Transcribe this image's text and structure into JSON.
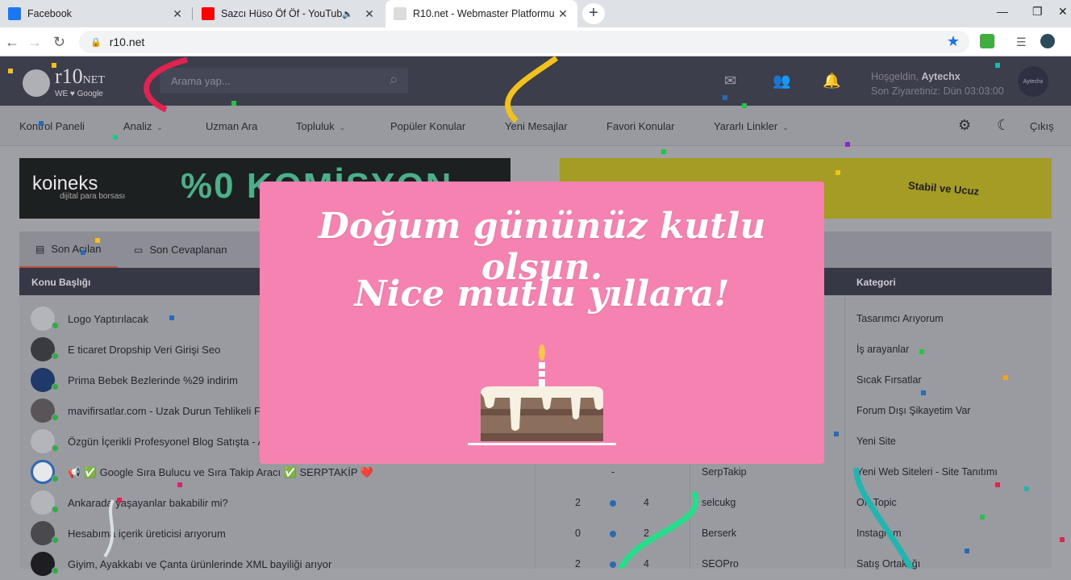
{
  "browser": {
    "tabs": [
      {
        "title": "Facebook",
        "favicon_color": "#1877f2"
      },
      {
        "title": "Sazcı Hüso Öf Öf - YouTube",
        "favicon_color": "#ff0000"
      },
      {
        "title": "R10.net - Webmaster Platformu",
        "favicon_color": "#333333"
      }
    ],
    "new_tab": "+",
    "url": "r10.net"
  },
  "site": {
    "logo_main": "r10",
    "logo_net": "NET",
    "logo_sub": "WE ♥ Google",
    "search_placeholder": "Arama yap...",
    "welcome_prefix": "Hoşgeldin, ",
    "username": "Aytechx",
    "last_visit": "Son Ziyaretiniz: Dün 03:03:00",
    "avatar_label": "Aytechx"
  },
  "menu": {
    "items": [
      {
        "label": "Kontrol Paneli",
        "caret": false
      },
      {
        "label": "Analiz",
        "caret": true
      },
      {
        "label": "Uzman Ara",
        "caret": false
      },
      {
        "label": "Topluluk",
        "caret": true
      },
      {
        "label": "Popüler Konular",
        "caret": false
      },
      {
        "label": "Yeni Mesajlar",
        "caret": false
      },
      {
        "label": "Favori Konular",
        "caret": false
      },
      {
        "label": "Yararlı Linkler",
        "caret": true
      }
    ],
    "logout": "Çıkış"
  },
  "banners": {
    "left_brand": "koineks",
    "left_tagline": "dijital para borsası",
    "left_headline": "%0 KOMİSYON",
    "right_text": "Stabil ve Ucuz"
  },
  "panel": {
    "tabs": [
      "Son Açılan",
      "Son Cevaplanan"
    ],
    "headers": {
      "topic": "Konu Başlığı",
      "category": "Kategori"
    },
    "rows": [
      {
        "title": "Logo Yaptırılacak",
        "replies": "",
        "views": "",
        "user": "",
        "category": "Tasarımcı Arıyorum"
      },
      {
        "title": "E ticaret Dropship Veri Girişi Seo",
        "replies": "",
        "views": "",
        "user": "",
        "category": "İş arayanlar"
      },
      {
        "title": "Prima Bebek Bezlerinde %29 indirim",
        "replies": "",
        "views": "",
        "user": "",
        "category": "Sıcak Fırsatlar"
      },
      {
        "title": "mavifirsatlar.com - Uzak Durun Tehlikeli F",
        "replies": "",
        "views": "",
        "user": "",
        "category": "Forum Dışı Şikayetim Var"
      },
      {
        "title": "Özgün İçerikli Profesyonel Blog Satışta - A",
        "replies": "",
        "views": "",
        "user": "",
        "category": "Yeni Site"
      },
      {
        "title": "📢 ✅ Google Sıra Bulucu ve Sıra Takip Aracı ✅ SERPTAKİP ❤️",
        "replies": "",
        "views": "-",
        "user": "SerpTakip",
        "category": "Yeni Web Siteleri - Site Tanıtımı"
      },
      {
        "title": "Ankarada yaşayanlar bakabilir mi?",
        "replies": "2",
        "views": "4",
        "user": "selcukg",
        "category": "Off-Topic"
      },
      {
        "title": "Hesabıma içerik üreticisi arıyorum",
        "replies": "0",
        "views": "2",
        "user": "Berserk",
        "category": "Instagram"
      },
      {
        "title": "Giyim, Ayakkabı ve Çanta ürünlerinde XML bayiliği arıyor",
        "replies": "2",
        "views": "4",
        "user": "SEOPro",
        "category": "Satış Ortaklığı"
      }
    ]
  },
  "birthday": {
    "line1": "Doğum gününüz kutlu olsun.",
    "line2": "Nice mutlu yıllara!",
    "background": "#f582b0"
  }
}
